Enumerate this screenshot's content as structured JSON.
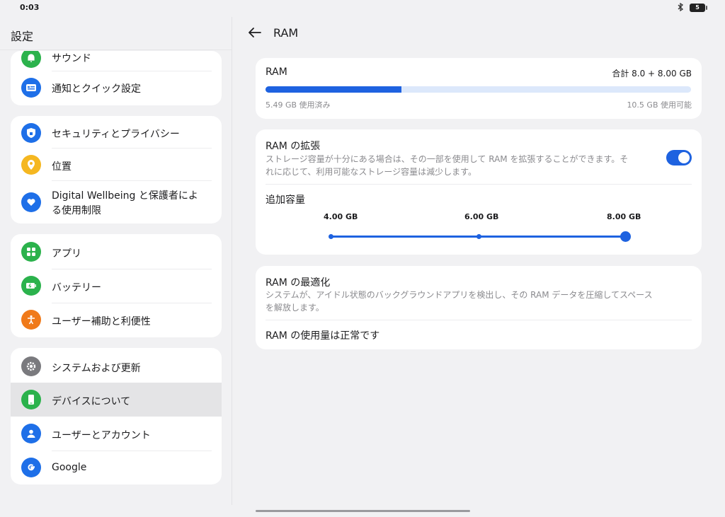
{
  "status": {
    "time": "0:03",
    "bluetooth": "✱",
    "battery": "5"
  },
  "left": {
    "title": "設定",
    "groups": [
      {
        "items": [
          {
            "label": "サウンド",
            "icon": "bell-icon",
            "color": "#2bb24c"
          },
          {
            "label": "通知とクイック設定",
            "icon": "notification-icon",
            "color": "#1e6fe8"
          }
        ]
      },
      {
        "items": [
          {
            "label": "セキュリティとプライバシー",
            "icon": "shield-lock-icon",
            "color": "#1e6fe8"
          },
          {
            "label": "位置",
            "icon": "location-pin-icon",
            "color": "#f5b720"
          },
          {
            "label": "Digital Wellbeing と保護者によ",
            "label2": "る使用制限",
            "icon": "heart-icon",
            "color": "#1e6fe8"
          }
        ]
      },
      {
        "items": [
          {
            "label": "アプリ",
            "icon": "apps-grid-icon",
            "color": "#2bb24c"
          },
          {
            "label": "バッテリー",
            "icon": "battery-icon",
            "color": "#2bb24c"
          },
          {
            "label": "ユーザー補助と利便性",
            "icon": "accessibility-icon",
            "color": "#f07a1a"
          }
        ]
      },
      {
        "items": [
          {
            "label": "システムおよび更新",
            "icon": "gear-icon",
            "color": "#7a7a7e"
          },
          {
            "label": "デバイスについて",
            "icon": "phone-icon",
            "color": "#2bb24c",
            "selected": true
          },
          {
            "label": "ユーザーとアカウント",
            "icon": "user-icon",
            "color": "#1e6fe8"
          },
          {
            "label": "Google",
            "icon": "google-icon",
            "color": "#1e6fe8"
          }
        ]
      }
    ]
  },
  "right": {
    "title": "RAM",
    "ram": {
      "title": "RAM",
      "total": "合計 8.0 + 8.00 GB",
      "used": "5.49 GB 使用済み",
      "available": "10.5 GB 使用可能",
      "used_fraction": 0.32,
      "bar_color": "#1e62e0",
      "track_color": "#dce8fb"
    },
    "expansion": {
      "title": "RAM の拡張",
      "desc1": "ストレージ容量が十分にある場合は、その一部を使用して RAM を拡張することができます。そ",
      "desc2": "れに応じて、利用可能なストレージ容量は減少します。",
      "toggle_on": true,
      "capacity_label": "追加容量",
      "steps": [
        "4.00 GB",
        "6.00 GB",
        "8.00 GB"
      ],
      "selected_step": "8.00 GB"
    },
    "optimization": {
      "title": "RAM の最適化",
      "desc1": "システムが、アイドル状態のバックグラウンドアプリを検出し、その RAM データを圧縮してスペース",
      "desc2": "を解放します。",
      "status": "RAM の使用量は正常です"
    }
  }
}
